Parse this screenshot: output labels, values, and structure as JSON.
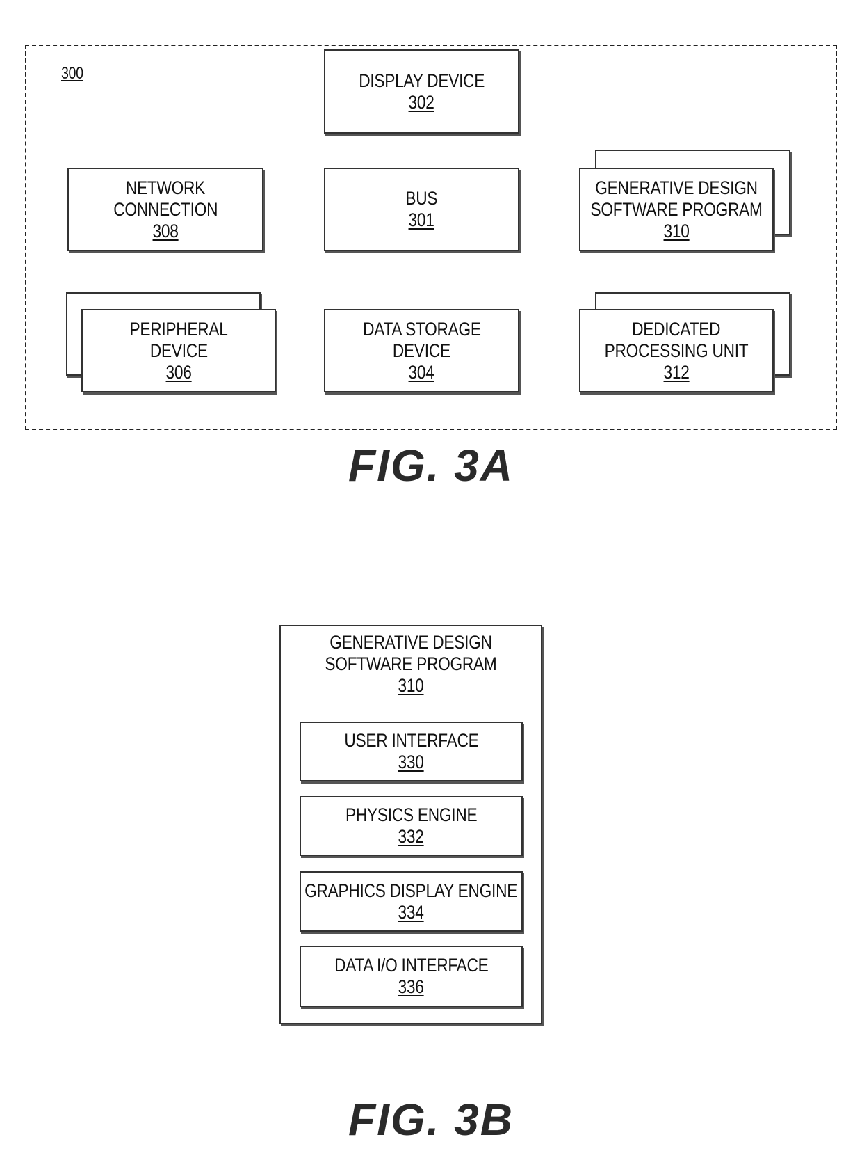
{
  "fig3a": {
    "system_ref": "300",
    "caption": "FIG. 3A",
    "blocks": {
      "display": {
        "lines": [
          "DISPLAY DEVICE"
        ],
        "ref": "302",
        "stacked": false
      },
      "network": {
        "lines": [
          "NETWORK",
          "CONNECTION"
        ],
        "ref": "308",
        "stacked": false
      },
      "bus": {
        "lines": [
          "BUS"
        ],
        "ref": "301",
        "stacked": false
      },
      "gen_design": {
        "lines": [
          "GENERATIVE DESIGN",
          "SOFTWARE PROGRAM"
        ],
        "ref": "310",
        "stacked": true
      },
      "peripheral": {
        "lines": [
          "PERIPHERAL",
          "DEVICE"
        ],
        "ref": "306",
        "stacked": true
      },
      "storage": {
        "lines": [
          "DATA STORAGE",
          "DEVICE"
        ],
        "ref": "304",
        "stacked": false
      },
      "dedicated": {
        "lines": [
          "DEDICATED",
          "PROCESSING UNIT"
        ],
        "ref": "312",
        "stacked": true
      }
    }
  },
  "fig3b": {
    "caption": "FIG. 3B",
    "container": {
      "lines": [
        "GENERATIVE DESIGN",
        "SOFTWARE PROGRAM"
      ],
      "ref": "310"
    },
    "modules": [
      {
        "lines": [
          "USER INTERFACE"
        ],
        "ref": "330"
      },
      {
        "lines": [
          "PHYSICS ENGINE"
        ],
        "ref": "332"
      },
      {
        "lines": [
          "GRAPHICS DISPLAY ENGINE"
        ],
        "ref": "334"
      },
      {
        "lines": [
          "DATA I/O INTERFACE"
        ],
        "ref": "336"
      }
    ]
  }
}
